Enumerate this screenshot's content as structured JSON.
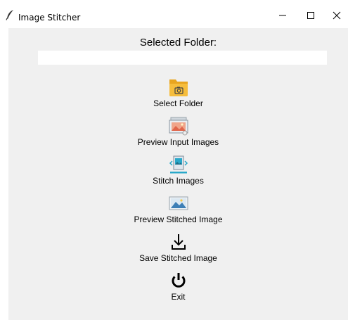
{
  "window": {
    "title": "Image Stitcher",
    "controls": {
      "minimize": "minimize-icon",
      "maximize": "maximize-icon",
      "close": "close-icon"
    }
  },
  "folder": {
    "label": "Selected Folder:",
    "value": ""
  },
  "actions": [
    {
      "label": "Select Folder",
      "icon": "folder-camera-icon"
    },
    {
      "label": "Preview Input Images",
      "icon": "photos-preview-icon"
    },
    {
      "label": "Stitch Images",
      "icon": "stitch-icon"
    },
    {
      "label": "Preview Stitched Image",
      "icon": "panorama-icon"
    },
    {
      "label": "Save Stitched Image",
      "icon": "download-icon"
    },
    {
      "label": "Exit",
      "icon": "power-icon"
    }
  ],
  "colors": {
    "background": "#f0f0f0",
    "folder": "#f2b632",
    "accent": "#29a8c9"
  }
}
